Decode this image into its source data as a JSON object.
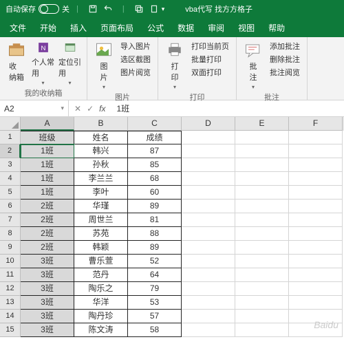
{
  "titlebar": {
    "autosave": "自动保存",
    "off": "关",
    "title": "vba代写  找方方格子"
  },
  "tabs": [
    "文件",
    "开始",
    "插入",
    "页面布局",
    "公式",
    "数据",
    "审阅",
    "视图",
    "帮助"
  ],
  "ribbon": {
    "g1": {
      "b1": "收\n纳箱",
      "b2": "个人常\n用",
      "b3": "定位引\n用",
      "label": "我的收纳箱"
    },
    "g2": {
      "b1": "图\n片",
      "l1": "导入图片",
      "l2": "选区截图",
      "l3": "图片阅览",
      "label": "图片"
    },
    "g3": {
      "b1": "打\n印",
      "l1": "打印当前页",
      "l2": "批量打印",
      "l3": "双面打印",
      "label": "打印"
    },
    "g4": {
      "b1": "批\n注",
      "l1": "添加批注",
      "l2": "删除批注",
      "l3": "批注阅览",
      "label": "批注"
    }
  },
  "namebox": {
    "ref": "A2",
    "fx": "fx",
    "value": "1班"
  },
  "cols": [
    "A",
    "B",
    "C",
    "D",
    "E",
    "F"
  ],
  "rows": [
    {
      "n": 1,
      "a": "班级",
      "b": "姓名",
      "c": "成绩"
    },
    {
      "n": 2,
      "a": "1班",
      "b": "韩兴",
      "c": "87"
    },
    {
      "n": 3,
      "a": "1班",
      "b": "孙秋",
      "c": "85"
    },
    {
      "n": 4,
      "a": "1班",
      "b": "李兰兰",
      "c": "68"
    },
    {
      "n": 5,
      "a": "1班",
      "b": "李叶",
      "c": "60"
    },
    {
      "n": 6,
      "a": "2班",
      "b": "华瑾",
      "c": "89"
    },
    {
      "n": 7,
      "a": "2班",
      "b": "周世兰",
      "c": "81"
    },
    {
      "n": 8,
      "a": "2班",
      "b": "苏苑",
      "c": "88"
    },
    {
      "n": 9,
      "a": "2班",
      "b": "韩颖",
      "c": "89"
    },
    {
      "n": 10,
      "a": "3班",
      "b": "曹乐萱",
      "c": "52"
    },
    {
      "n": 11,
      "a": "3班",
      "b": "范丹",
      "c": "64"
    },
    {
      "n": 12,
      "a": "3班",
      "b": "陶乐之",
      "c": "79"
    },
    {
      "n": 13,
      "a": "3班",
      "b": "华洋",
      "c": "53"
    },
    {
      "n": 14,
      "a": "3班",
      "b": "陶丹珍",
      "c": "57"
    },
    {
      "n": 15,
      "a": "3班",
      "b": "陈文涛",
      "c": "58"
    }
  ],
  "watermark": "Baidu"
}
